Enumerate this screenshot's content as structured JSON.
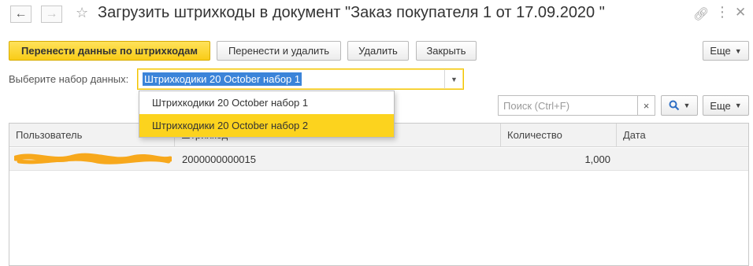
{
  "window": {
    "title": "Загрузить штрихкоды в документ \"Заказ покупателя 1 от 17.09.2020 \""
  },
  "toolbar": {
    "transfer_label": "Перенести данные по штрихкодам",
    "transfer_delete_label": "Перенести и удалить",
    "delete_label": "Удалить",
    "close_label": "Закрыть",
    "more_label": "Еще"
  },
  "dataset": {
    "label": "Выберите набор данных:",
    "value": "Штрихкодики 20 October набор 1",
    "options": [
      "Штрихкодики 20 October набор 1",
      "Штрихкодики 20 October набор 2"
    ],
    "highlighted_option_index": 1
  },
  "search": {
    "placeholder": "Поиск (Ctrl+F)",
    "clear_icon": "×",
    "more_label": "Еще"
  },
  "table": {
    "columns": [
      "Пользователь",
      "Штрихкод",
      "Количество",
      "Дата"
    ],
    "rows": [
      {
        "user": "",
        "barcode": "2000000000015",
        "quantity": "1,000",
        "date": ""
      }
    ]
  },
  "colors": {
    "primary_button": "#f9cc17",
    "selection_highlight": "#fcd31e",
    "text_selection": "#3b84d9",
    "redaction_mark": "#f7a81c"
  }
}
